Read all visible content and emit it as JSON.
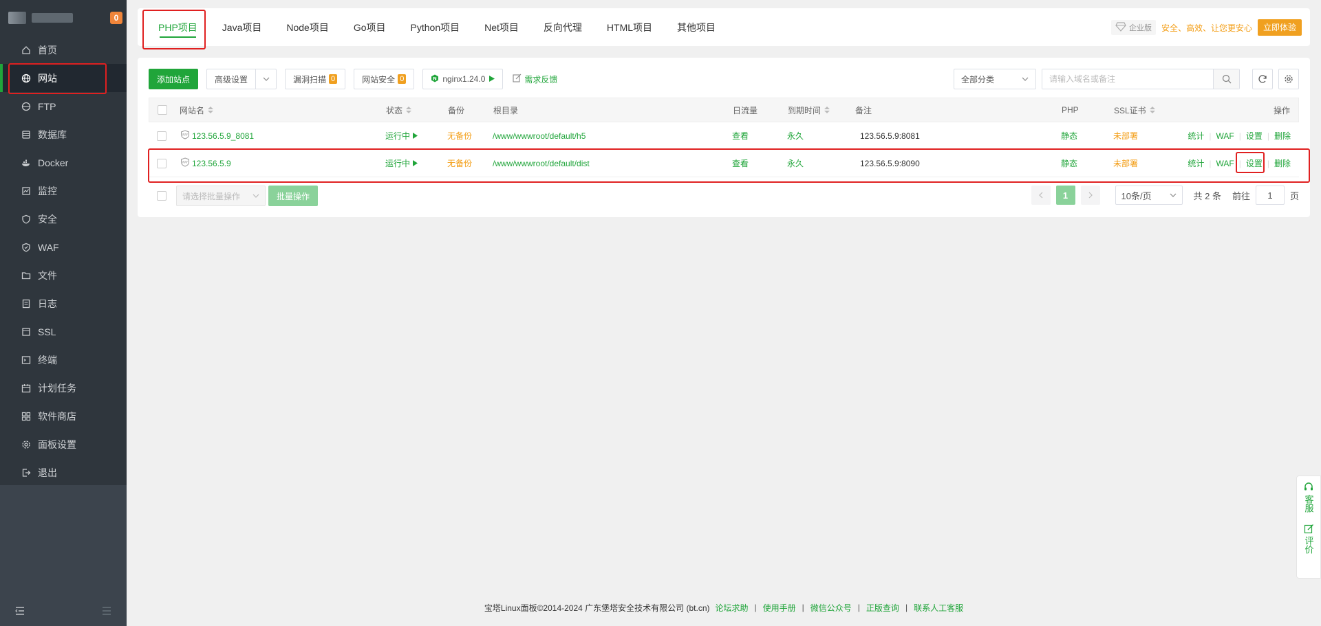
{
  "sidebar": {
    "badge": "0",
    "items": [
      {
        "label": "首页",
        "icon": "home-icon"
      },
      {
        "label": "网站",
        "icon": "globe-icon"
      },
      {
        "label": "FTP",
        "icon": "ftp-icon"
      },
      {
        "label": "数据库",
        "icon": "database-icon"
      },
      {
        "label": "Docker",
        "icon": "docker-icon"
      },
      {
        "label": "监控",
        "icon": "monitor-icon"
      },
      {
        "label": "安全",
        "icon": "shield-icon"
      },
      {
        "label": "WAF",
        "icon": "waf-icon"
      },
      {
        "label": "文件",
        "icon": "folder-icon"
      },
      {
        "label": "日志",
        "icon": "log-icon"
      },
      {
        "label": "SSL",
        "icon": "ssl-icon"
      },
      {
        "label": "终端",
        "icon": "terminal-icon"
      },
      {
        "label": "计划任务",
        "icon": "calendar-icon"
      },
      {
        "label": "软件商店",
        "icon": "store-icon"
      },
      {
        "label": "面板设置",
        "icon": "gear-icon"
      },
      {
        "label": "退出",
        "icon": "logout-icon"
      }
    ],
    "active_index": 1
  },
  "tabs": [
    "PHP项目",
    "Java项目",
    "Node项目",
    "Go项目",
    "Python项目",
    "Net项目",
    "反向代理",
    "HTML项目",
    "其他项目"
  ],
  "enterprise": {
    "badge": "企业版",
    "slogan": "安全、高效、让您更安心",
    "button": "立即体验"
  },
  "toolbar": {
    "add_site": "添加站点",
    "advanced": "高级设置",
    "vuln_scan": "漏洞扫描",
    "vuln_count": "0",
    "site_security": "网站安全",
    "security_count": "0",
    "nginx": "nginx1.24.0",
    "feedback": "需求反馈",
    "category": "全部分类",
    "search_placeholder": "请输入域名或备注"
  },
  "table": {
    "headers": {
      "name": "网站名",
      "status": "状态",
      "backup": "备份",
      "root": "根目录",
      "traffic": "日流量",
      "expire": "到期时间",
      "note": "备注",
      "php": "PHP",
      "ssl": "SSL证书",
      "ops": "操作"
    },
    "rows": [
      {
        "name": "123.56.5.9_8081",
        "status": "运行中",
        "backup": "无备份",
        "root": "/www/wwwroot/default/h5",
        "traffic": "查看",
        "expire": "永久",
        "note": "123.56.5.9:8081",
        "php": "静态",
        "ssl": "未部署",
        "ops": [
          "统计",
          "WAF",
          "设置",
          "删除"
        ]
      },
      {
        "name": "123.56.5.9",
        "status": "运行中",
        "backup": "无备份",
        "root": "/www/wwwroot/default/dist",
        "traffic": "查看",
        "expire": "永久",
        "note": "123.56.5.9:8090",
        "php": "静态",
        "ssl": "未部署",
        "ops": [
          "统计",
          "WAF",
          "设置",
          "删除"
        ]
      }
    ]
  },
  "batch": {
    "select_placeholder": "请选择批量操作",
    "button": "批量操作"
  },
  "pager": {
    "current": "1",
    "page_size": "10条/页",
    "total": "共 2 条",
    "goto_label": "前往",
    "goto_value": "1",
    "page_unit": "页"
  },
  "footer": {
    "copyright": "宝塔Linux面板©2014-2024 广东堡塔安全技术有限公司 (bt.cn)",
    "links": [
      "论坛求助",
      "使用手册",
      "微信公众号",
      "正版查询",
      "联系人工客服"
    ]
  },
  "float": {
    "service": "客服",
    "review": "评价"
  },
  "colors": {
    "accent": "#20a53a",
    "warning": "#f39c12",
    "annotation": "#e02020"
  }
}
